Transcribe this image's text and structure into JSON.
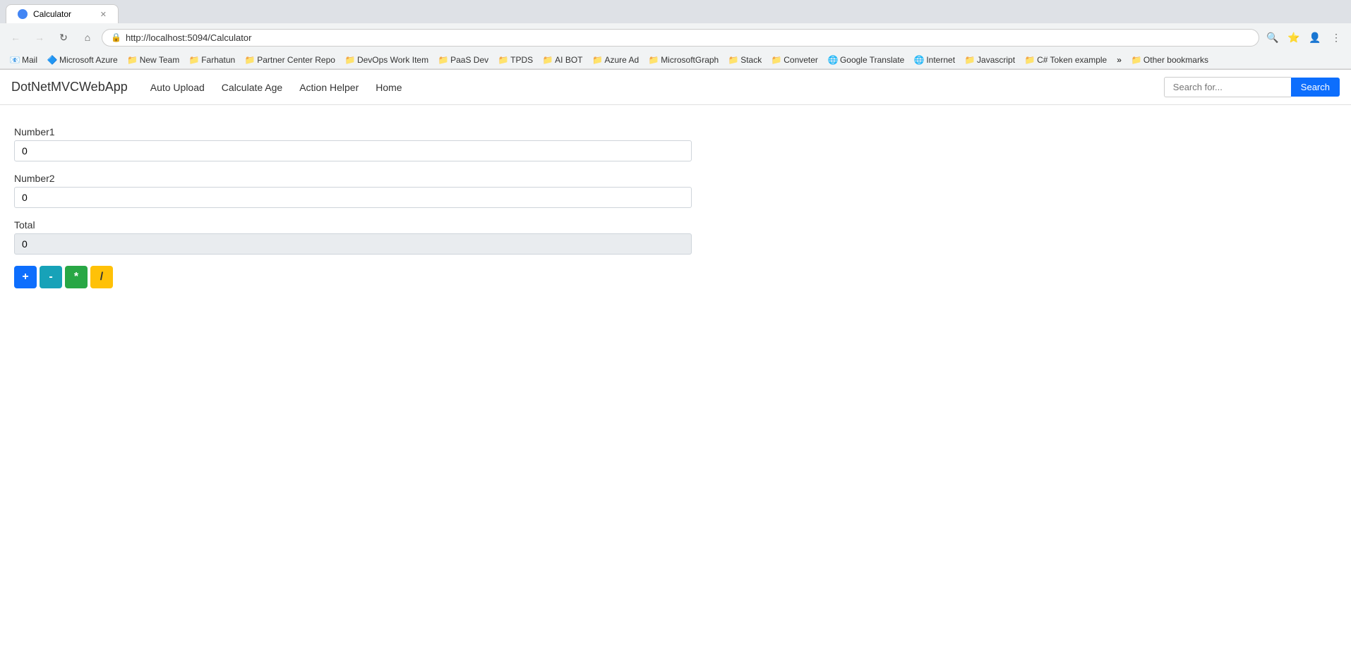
{
  "browser": {
    "tab": {
      "title": "Calculator",
      "url": "http://localhost:5094/Calculator"
    },
    "nav_buttons": {
      "back": "←",
      "forward": "→",
      "refresh": "↻",
      "home": "⌂"
    },
    "toolbar_icons": [
      "🔍",
      "⭐",
      "👤"
    ]
  },
  "bookmarks": [
    {
      "id": "mail",
      "label": "Mail",
      "icon": "📧"
    },
    {
      "id": "microsoft-azure",
      "label": "Microsoft Azure",
      "icon": "🔷"
    },
    {
      "id": "new-team",
      "label": "New Team",
      "icon": "📁"
    },
    {
      "id": "farhatun",
      "label": "Farhatun",
      "icon": "📁"
    },
    {
      "id": "partner-center-repo",
      "label": "Partner Center Repo",
      "icon": "📁"
    },
    {
      "id": "devops-work-item",
      "label": "DevOps Work Item",
      "icon": "📁"
    },
    {
      "id": "paas-dev",
      "label": "PaaS Dev",
      "icon": "📁"
    },
    {
      "id": "tpds",
      "label": "TPDS",
      "icon": "📁"
    },
    {
      "id": "ai-bot",
      "label": "AI BOT",
      "icon": "📁"
    },
    {
      "id": "azure-ad",
      "label": "Azure Ad",
      "icon": "📁"
    },
    {
      "id": "microsoftgraph",
      "label": "MicrosoftGraph",
      "icon": "📁"
    },
    {
      "id": "stack",
      "label": "Stack",
      "icon": "📁"
    },
    {
      "id": "conveter",
      "label": "Conveter",
      "icon": "📁"
    },
    {
      "id": "google-translate",
      "label": "Google Translate",
      "icon": "🌐"
    },
    {
      "id": "internet",
      "label": "Internet",
      "icon": "🌐"
    },
    {
      "id": "javascript",
      "label": "Javascript",
      "icon": "📁"
    },
    {
      "id": "csharp-token",
      "label": "C# Token example",
      "icon": "📁"
    },
    {
      "id": "more",
      "label": "»",
      "icon": ""
    },
    {
      "id": "other-bookmarks",
      "label": "Other bookmarks",
      "icon": "📁"
    }
  ],
  "app": {
    "brand": "DotNetMVCWebApp",
    "nav_links": [
      {
        "id": "auto-upload",
        "label": "Auto Upload"
      },
      {
        "id": "calculate-age",
        "label": "Calculate Age"
      },
      {
        "id": "action-helper",
        "label": "Action Helper"
      },
      {
        "id": "home",
        "label": "Home"
      }
    ],
    "search": {
      "placeholder": "Search for...",
      "button_label": "Search"
    }
  },
  "calculator": {
    "number1_label": "Number1",
    "number1_value": "0",
    "number2_label": "Number2",
    "number2_value": "0",
    "total_label": "Total",
    "total_value": "0",
    "buttons": {
      "add": "+",
      "subtract": "-",
      "multiply": "*",
      "divide": "/"
    }
  }
}
